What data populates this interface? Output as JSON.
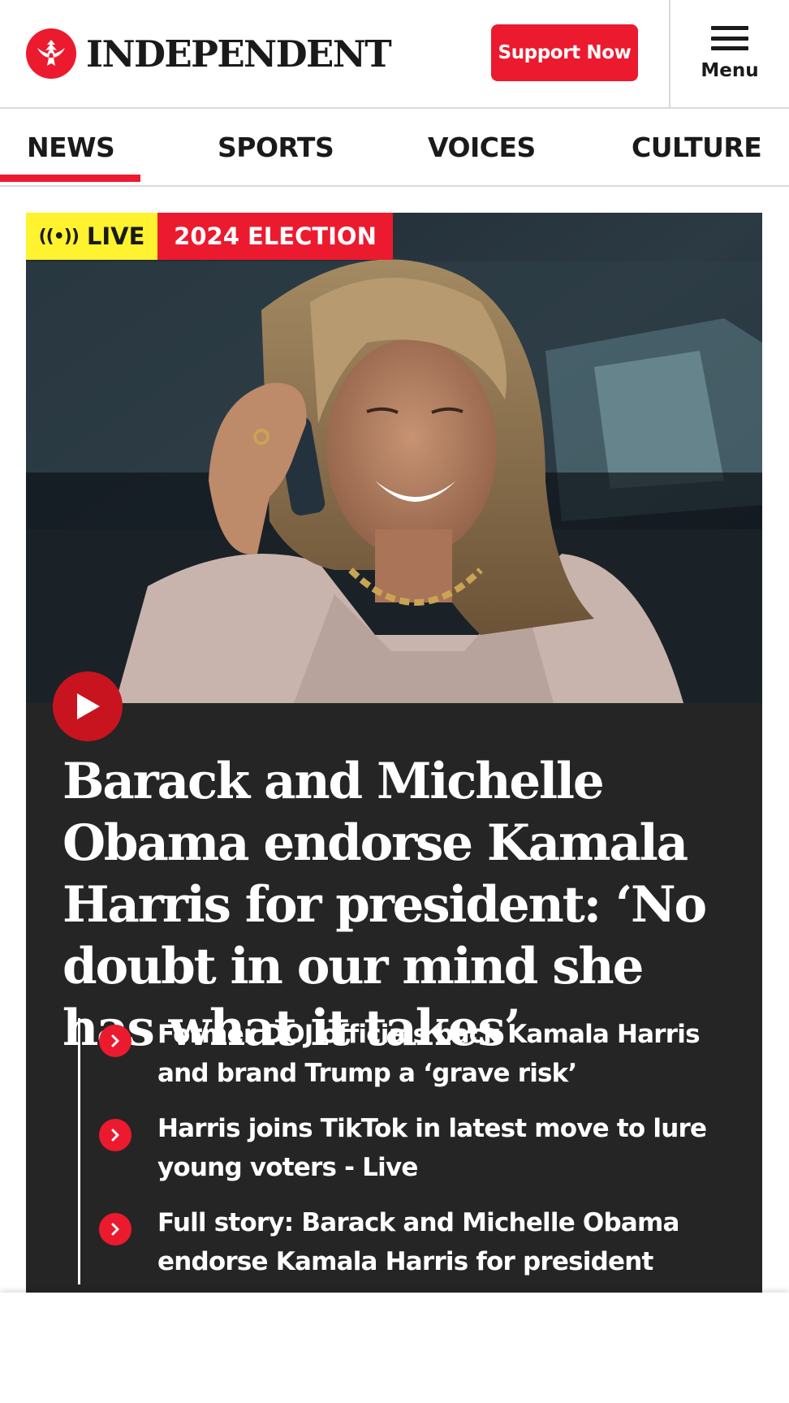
{
  "header": {
    "logo_text": "INDEPENDENT",
    "support_label": "Support Now",
    "menu_label": "Menu"
  },
  "nav": {
    "items": [
      {
        "label": "NEWS",
        "active": true
      },
      {
        "label": "SPORTS",
        "active": false
      },
      {
        "label": "VOICES",
        "active": false
      },
      {
        "label": "CULTURE",
        "active": false
      }
    ]
  },
  "hero": {
    "live_label": "LIVE",
    "tag_label": "2024 ELECTION",
    "headline": "Barack and Michelle Obama endorse Kamala Harris for president: ‘No doubt in our mind she has what it takes’",
    "related": [
      {
        "text": "Former DOJ officials back Kamala Harris and brand Trump a ‘grave risk’"
      },
      {
        "text": "Harris joins TikTok in latest move to lure young voters - Live"
      },
      {
        "text": "Full story: Barack and Michelle Obama endorse Kamala Harris for president"
      }
    ]
  },
  "icons": {
    "logo": "eagle-logo-icon",
    "menu": "hamburger-icon",
    "live": "broadcast-icon",
    "play": "play-icon",
    "related": "chevron-right-icon"
  },
  "colors": {
    "brand_red": "#ec1a2e",
    "live_yellow": "#fff22e",
    "card_bg": "#252525",
    "text_dark": "#1a1a1a"
  }
}
